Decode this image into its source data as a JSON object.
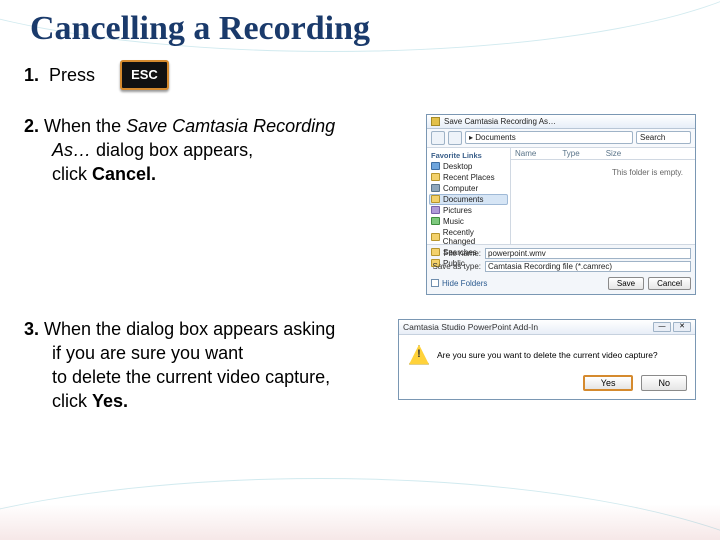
{
  "title": "Cancelling a Recording",
  "step1": {
    "num": "1.",
    "text": "Press",
    "key_label": "ESC"
  },
  "step2": {
    "num": "2.",
    "l1a": "When the ",
    "l1_italic": "Save Camtasia Recording",
    "l2_italic": "As…",
    "l2b": " dialog box appears,",
    "l3a": "click ",
    "l3_bold": "Cancel."
  },
  "step3": {
    "num": "3.",
    "l1": "When the dialog box appears asking",
    "l2": "if you are sure you want",
    "l3": "to delete the current video capture,",
    "l4a": "click ",
    "l4_bold": "Yes."
  },
  "save_dialog": {
    "title": "Save Camtasia Recording As…",
    "path": "▸ Documents",
    "search": "Search",
    "cols": {
      "name": "Name",
      "type": "Type",
      "size": "Size"
    },
    "empty": "This folder is empty.",
    "side_header": "Favorite Links",
    "side": [
      "Desktop",
      "Recent Places",
      "Computer",
      "Documents",
      "Pictures",
      "Music",
      "Recently Changed",
      "Searches",
      "Public"
    ],
    "filename_label": "File name:",
    "filename_value": "powerpoint.wmv",
    "savetype_label": "Save as type:",
    "savetype_value": "Camtasia Recording file (*.camrec)",
    "hide_folders": "Hide Folders",
    "save": "Save",
    "cancel": "Cancel"
  },
  "confirm_dialog": {
    "title": "Camtasia Studio PowerPoint Add-In",
    "message": "Are you sure you want to delete the current video capture?",
    "yes": "Yes",
    "no": "No"
  }
}
